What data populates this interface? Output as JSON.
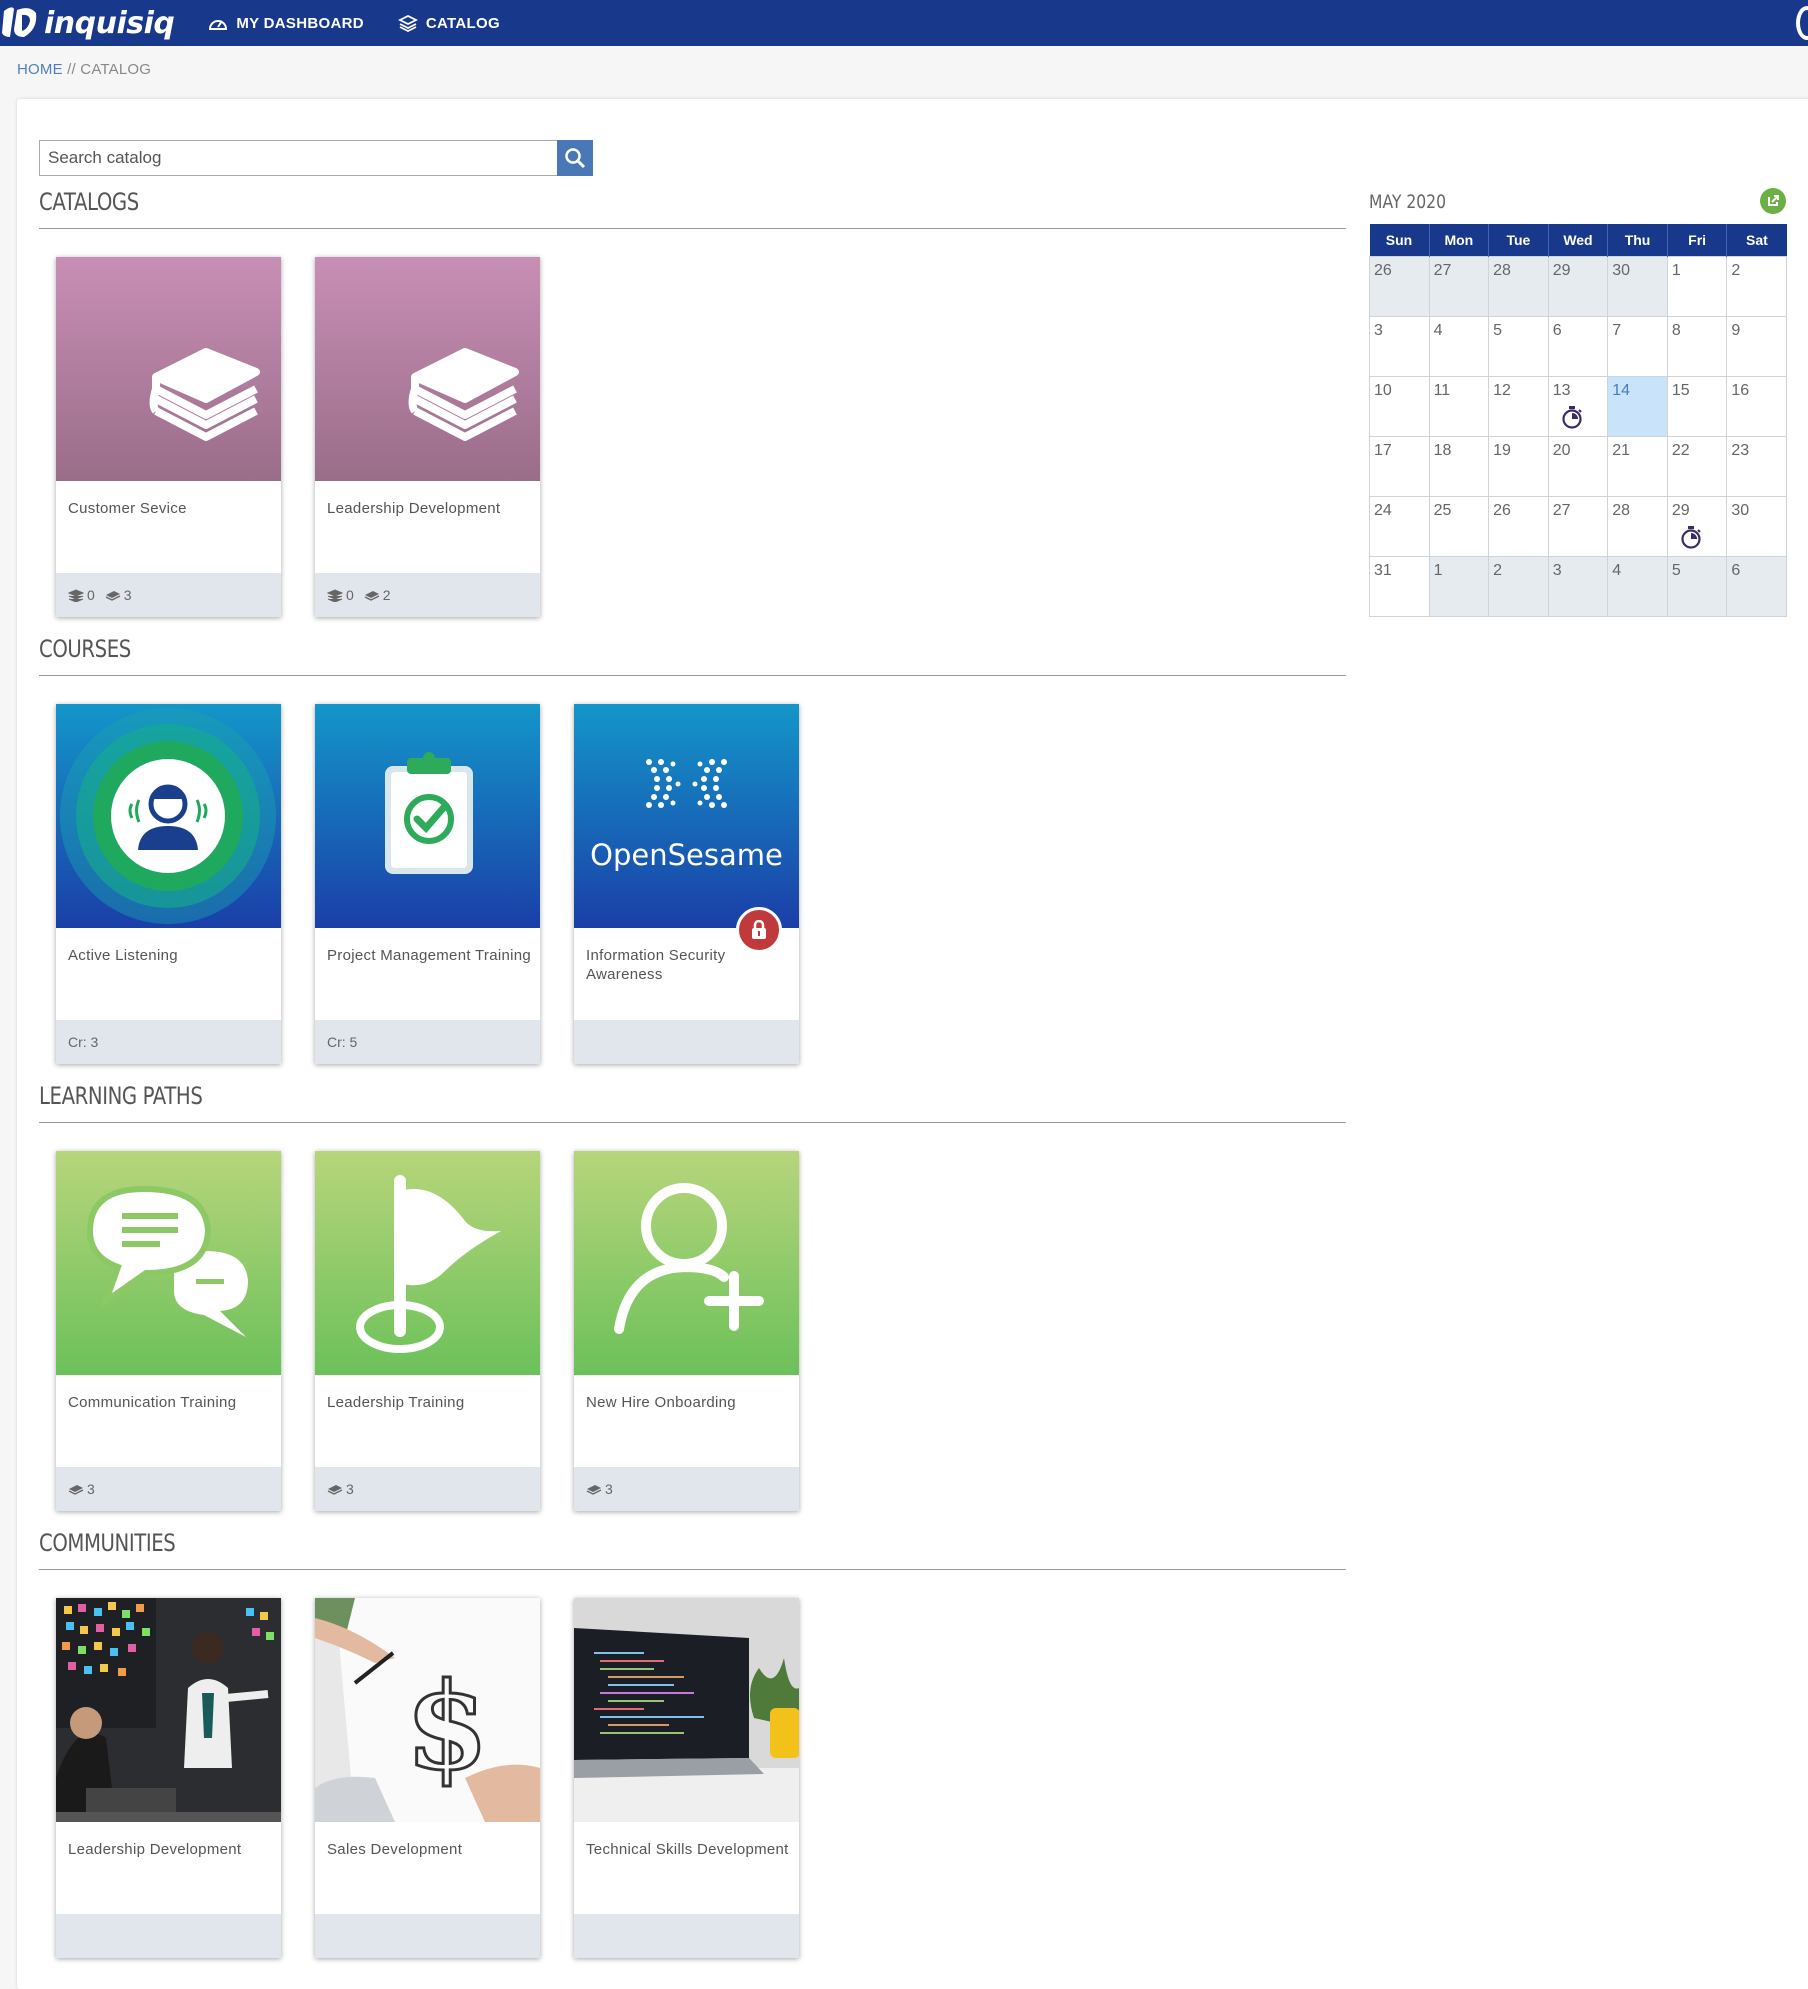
{
  "app": {
    "logo_text": "inquisiq",
    "nav": [
      {
        "label": "MY DASHBOARD",
        "icon": "dashboard-icon"
      },
      {
        "label": "CATALOG",
        "icon": "catalog-icon"
      }
    ]
  },
  "breadcrumb": {
    "home": "HOME",
    "separator": " // ",
    "current": "CATALOG"
  },
  "search": {
    "placeholder": "Search catalog"
  },
  "sections": {
    "catalogs": {
      "title": "CATALOGS",
      "items": [
        {
          "title": "Customer Sevice",
          "subcatalogs": "0",
          "courses": "3"
        },
        {
          "title": "Leadership Development",
          "subcatalogs": "0",
          "courses": "2"
        }
      ]
    },
    "courses": {
      "title": "COURSES",
      "items": [
        {
          "title": "Active Listening",
          "footer": "Cr: 3"
        },
        {
          "title": "Project Management Training",
          "footer": "Cr: 5"
        },
        {
          "title": "Information Security Awareness",
          "footer": "",
          "thumb_text": "OpenSesame",
          "locked": true
        }
      ]
    },
    "learning_paths": {
      "title": "LEARNING PATHS",
      "items": [
        {
          "title": "Communication Training",
          "courses": "3"
        },
        {
          "title": "Leadership Training",
          "courses": "3"
        },
        {
          "title": "New Hire Onboarding",
          "courses": "3"
        }
      ]
    },
    "communities": {
      "title": "COMMUNITIES",
      "items": [
        {
          "title": "Leadership Development"
        },
        {
          "title": "Sales Development"
        },
        {
          "title": "Technical Skills Development"
        }
      ]
    }
  },
  "calendar": {
    "title": "MAY 2020",
    "weekdays": [
      "Sun",
      "Mon",
      "Tue",
      "Wed",
      "Thu",
      "Fri",
      "Sat"
    ],
    "weeks": [
      [
        "26",
        "27",
        "28",
        "29",
        "30",
        "1",
        "2"
      ],
      [
        "3",
        "4",
        "5",
        "6",
        "7",
        "8",
        "9"
      ],
      [
        "10",
        "11",
        "12",
        "13",
        "14",
        "15",
        "16"
      ],
      [
        "17",
        "18",
        "19",
        "20",
        "21",
        "22",
        "23"
      ],
      [
        "24",
        "25",
        "26",
        "27",
        "28",
        "29",
        "30"
      ],
      [
        "31",
        "1",
        "2",
        "3",
        "4",
        "5",
        "6"
      ]
    ],
    "today": "14",
    "event_days": [
      "13",
      "29"
    ],
    "colors": {
      "header": "#17388b",
      "today": "#c9e3fb",
      "outside_month": "#e6ebf0"
    }
  },
  "colors": {
    "topbar": "#17388b",
    "accent": "#4a78b6",
    "catalog": "#b583a4",
    "course": "#1a6fc0",
    "learning_path": "#8cc965"
  }
}
